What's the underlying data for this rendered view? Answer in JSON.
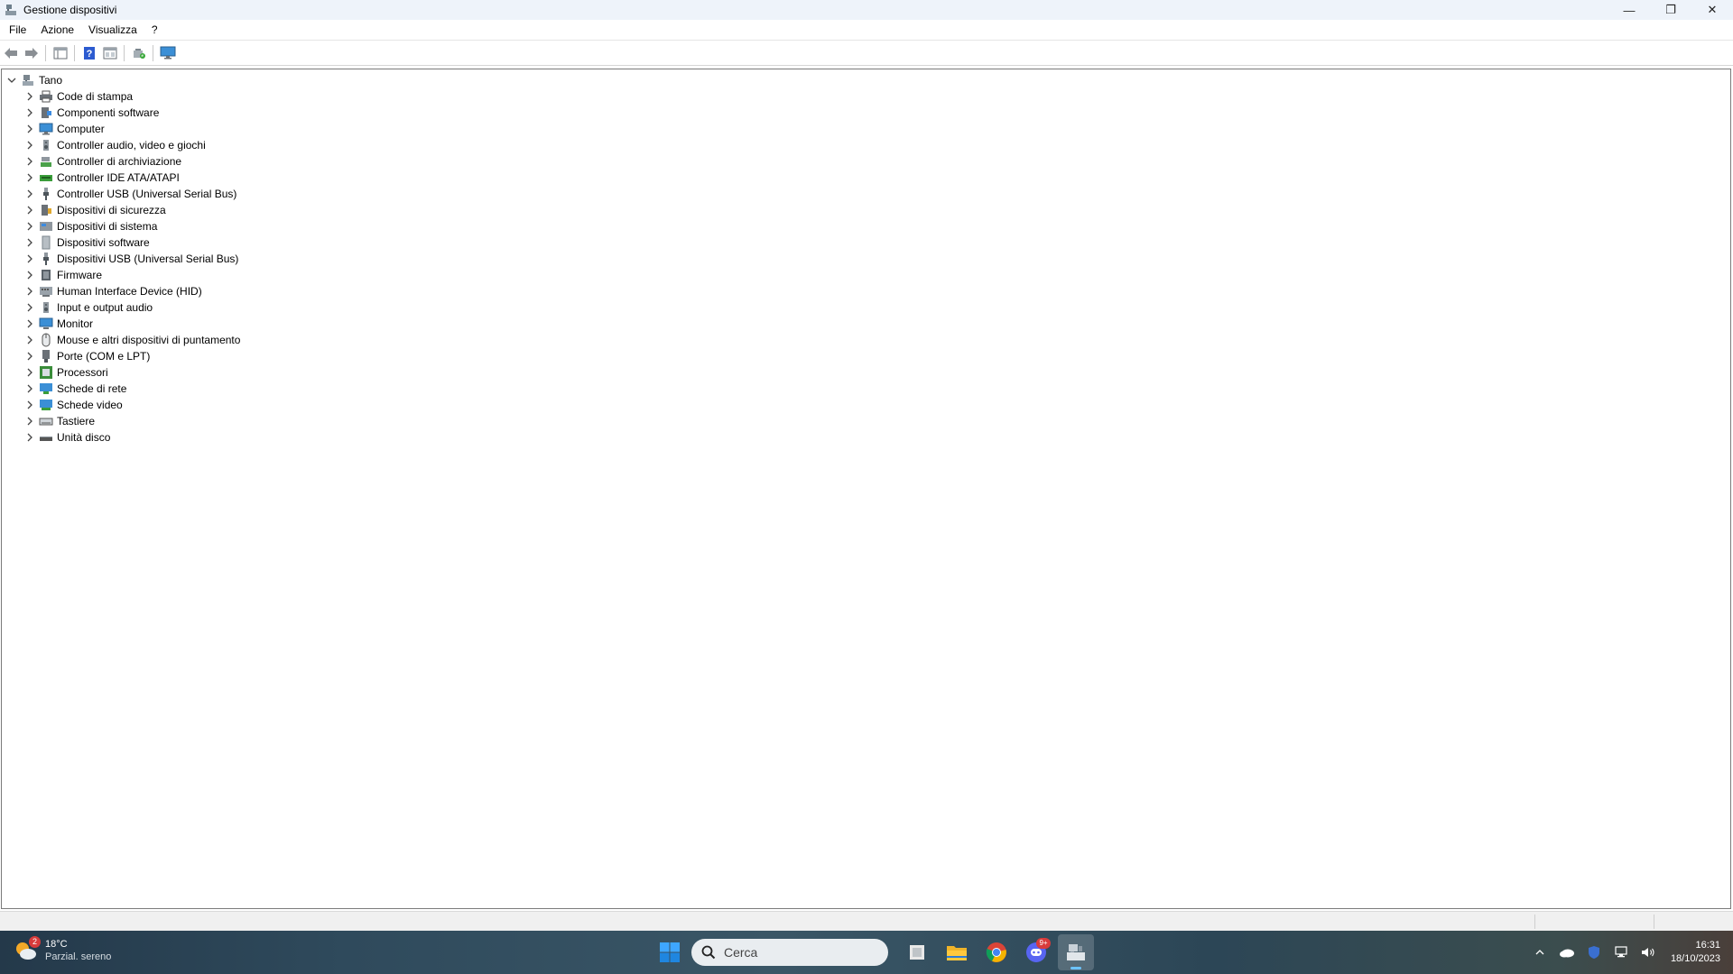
{
  "window": {
    "title": "Gestione dispositivi",
    "controls": {
      "minimize": "—",
      "restore": "❐",
      "close": "✕"
    }
  },
  "menu": [
    "File",
    "Azione",
    "Visualizza",
    "?"
  ],
  "toolbar": {
    "buttons": [
      "back-arrow-icon",
      "forward-arrow-icon",
      "show-hide-console-tree-icon",
      "help-icon",
      "properties-icon",
      "scan-hardware-icon",
      "computer-monitor-icon"
    ]
  },
  "tree": {
    "root": "Tano",
    "items": [
      {
        "label": "Code di stampa",
        "icon": "printer-icon"
      },
      {
        "label": "Componenti software",
        "icon": "software-component-icon"
      },
      {
        "label": "Computer",
        "icon": "computer-icon"
      },
      {
        "label": "Controller audio, video e giochi",
        "icon": "speaker-icon"
      },
      {
        "label": "Controller di archiviazione",
        "icon": "storage-controller-icon"
      },
      {
        "label": "Controller IDE ATA/ATAPI",
        "icon": "ide-controller-icon"
      },
      {
        "label": "Controller USB (Universal Serial Bus)",
        "icon": "usb-icon"
      },
      {
        "label": "Dispositivi di sicurezza",
        "icon": "security-device-icon"
      },
      {
        "label": "Dispositivi di sistema",
        "icon": "system-device-icon"
      },
      {
        "label": "Dispositivi software",
        "icon": "software-device-icon"
      },
      {
        "label": "Dispositivi USB (Universal Serial Bus)",
        "icon": "usb-icon"
      },
      {
        "label": "Firmware",
        "icon": "firmware-icon"
      },
      {
        "label": "Human Interface Device (HID)",
        "icon": "hid-icon"
      },
      {
        "label": "Input e output audio",
        "icon": "speaker-icon"
      },
      {
        "label": "Monitor",
        "icon": "monitor-icon"
      },
      {
        "label": "Mouse e altri dispositivi di puntamento",
        "icon": "mouse-icon"
      },
      {
        "label": "Porte (COM e LPT)",
        "icon": "port-icon"
      },
      {
        "label": "Processori",
        "icon": "processor-icon"
      },
      {
        "label": "Schede di rete",
        "icon": "network-adapter-icon"
      },
      {
        "label": "Schede video",
        "icon": "display-adapter-icon"
      },
      {
        "label": "Tastiere",
        "icon": "keyboard-icon"
      },
      {
        "label": "Unità disco",
        "icon": "disk-drive-icon"
      }
    ]
  },
  "taskbar": {
    "weather": {
      "badge": "2",
      "temp": "18°C",
      "desc": "Parzial. sereno"
    },
    "search_placeholder": "Cerca",
    "discord_badge": "9+",
    "clock": {
      "time": "16:31",
      "date": "18/10/2023"
    }
  },
  "colors": {
    "titlebar": "#eef3fa",
    "accent": "#0078d4",
    "tree_border": "#7a7a7a"
  }
}
